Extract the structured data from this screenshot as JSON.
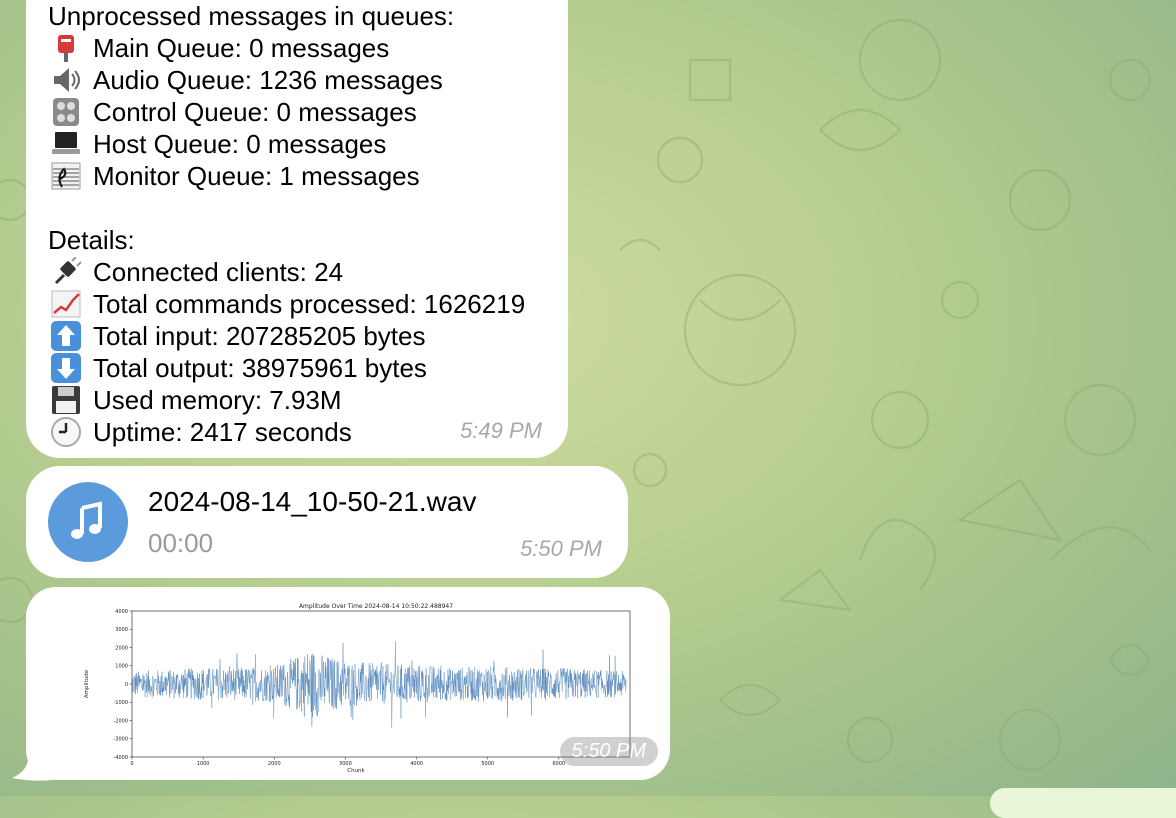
{
  "status_message": {
    "lines": [
      {
        "icon": "",
        "text": "Unprocessed messages in queues:"
      },
      {
        "icon": "postbox-icon",
        "text": "Main Queue: 0 messages"
      },
      {
        "icon": "speaker-icon",
        "text": "Audio Queue: 1236 messages"
      },
      {
        "icon": "control-knobs-icon",
        "text": "Control Queue: 0 messages"
      },
      {
        "icon": "laptop-icon",
        "text": "Host Queue: 0 messages"
      },
      {
        "icon": "musical-score-icon",
        "text": "Monitor Queue: 1 messages"
      },
      {
        "icon": "",
        "text": ""
      },
      {
        "icon": "",
        "text": "Details:"
      },
      {
        "icon": "electric-plug-icon",
        "text": "Connected clients: 24"
      },
      {
        "icon": "chart-increasing-icon",
        "text": "Total commands processed: 1626219"
      },
      {
        "icon": "up-arrow-icon",
        "text": "Total input: 207285205 bytes"
      },
      {
        "icon": "down-arrow-icon",
        "text": "Total output: 38975961 bytes"
      },
      {
        "icon": "floppy-disk-icon",
        "text": "Used memory: 7.93M"
      },
      {
        "icon": "clock-icon",
        "text": "Uptime: 2417 seconds"
      }
    ],
    "time": "5:49 PM"
  },
  "audio_message": {
    "icon": "music-note-icon",
    "file_name": "2024-08-14_10-50-21.wav",
    "duration": "00:00",
    "time": "5:50 PM"
  },
  "chart_message": {
    "time": "5:50 PM"
  },
  "chart_data": {
    "type": "line",
    "title": "Amplitude Over Time 2024-08-14 10:50:22.488947",
    "xlabel": "Chunk",
    "ylabel": "Amplitude",
    "xlim": [
      0,
      7000
    ],
    "ylim": [
      -4000,
      4000
    ],
    "xticks": [
      0,
      1000,
      2000,
      3000,
      4000,
      5000,
      6000
    ],
    "yticks": [
      4000,
      3000,
      2000,
      1000,
      0,
      -1000,
      -2000,
      -3000,
      -4000
    ],
    "series": [
      {
        "color": "#4e82b8",
        "envelope_x": [
          0,
          500,
          1000,
          1500,
          2000,
          2300,
          2500,
          2700,
          3000,
          3500,
          4000,
          4500,
          5000,
          5500,
          6000,
          6500,
          7000
        ],
        "envelope_amp": [
          700,
          800,
          900,
          900,
          1000,
          1500,
          2000,
          1600,
          1300,
          1100,
          1100,
          900,
          1000,
          900,
          900,
          800,
          700
        ]
      }
    ],
    "grid": false
  }
}
